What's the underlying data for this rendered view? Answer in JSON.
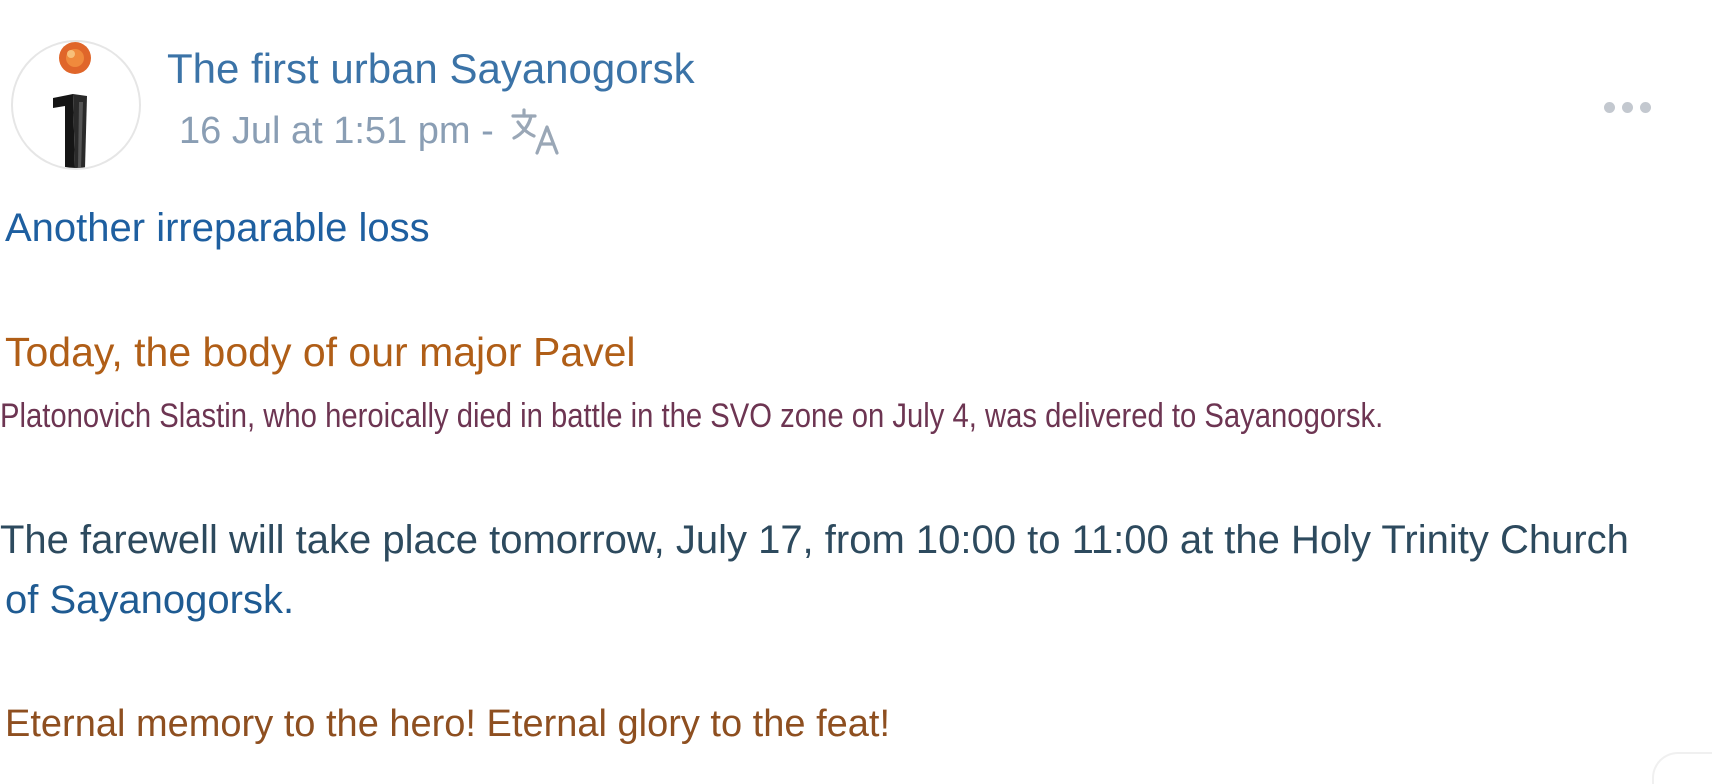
{
  "post": {
    "author": "The first urban Sayanogorsk",
    "timestamp": "16 Jul at 1:51 pm -",
    "icons": {
      "translate": "translate-icon",
      "more": "more-options-icon",
      "avatar": "candle-logo"
    },
    "text_lines": [
      "Another irreparable loss",
      "Today, the body of our major Pavel",
      "Platonovich Slastin, who heroically died in battle in the SVO zone on July 4, was delivered to Sayanogorsk.",
      "The farewell will take place tomorrow, July 17, from 10:00 to 11:00 at the Holy Trinity Church",
      "of Sayanogorsk.",
      "Eternal memory to the hero! Eternal glory to the feat!"
    ],
    "colors": {
      "author": "#3b73a7",
      "timestamp": "#8a9eb4",
      "line1": "#1e5fa0",
      "line2": "#b05e17",
      "line3": "#6d3552",
      "line4": "#2d4a5e",
      "line5": "#1f5b92",
      "line6": "#8e4f20"
    }
  }
}
